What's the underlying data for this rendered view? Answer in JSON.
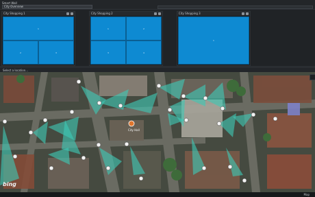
{
  "header": {
    "title": "Smart Wall",
    "selected_view": "City Overview"
  },
  "views": [
    {
      "title": "City Shopping 1",
      "cells": [
        "1",
        "2",
        "3"
      ]
    },
    {
      "title": "City Shopping 2",
      "cells": [
        "1",
        "2",
        "3",
        "4"
      ]
    },
    {
      "title": "City Shopping 3",
      "cells": [
        "1"
      ]
    }
  ],
  "map": {
    "toolbar_label": "Select a location...",
    "attribution": "bing",
    "marker_label": "City Hall"
  },
  "statusbar": {
    "label": "Map"
  },
  "colors": {
    "view_blue": "#0e8ad2",
    "camera_cone": "#3fc8b4",
    "background": "#1c1e20"
  }
}
